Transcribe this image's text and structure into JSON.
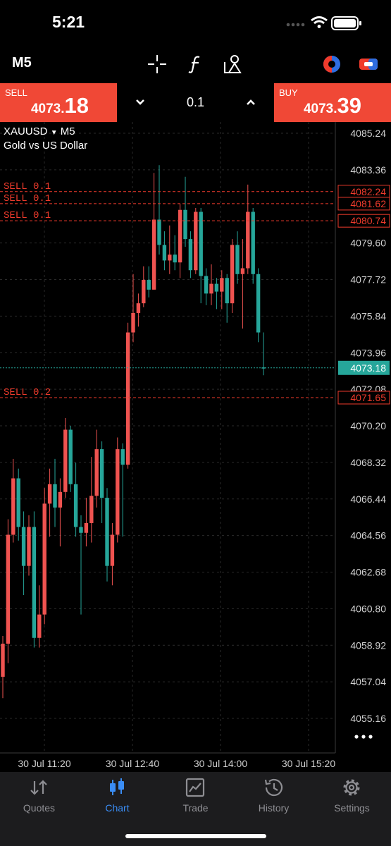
{
  "status_bar": {
    "time": "5:21"
  },
  "toolbar": {
    "timeframe": "M5",
    "icons": [
      "crosshair-icon",
      "function-icon",
      "objects-icon",
      "chart-color-icon",
      "one-click-trading-icon"
    ]
  },
  "trade": {
    "sell_label": "SELL",
    "sell_price_main": "4073.",
    "sell_price_big": "18",
    "buy_label": "BUY",
    "buy_price_main": "4073.",
    "buy_price_big": "39",
    "volume": "0.1"
  },
  "chart": {
    "symbol": "XAUUSD",
    "timeframe": "M5",
    "description": "Gold vs US Dollar",
    "bid_label": "4073.18",
    "orders": [
      {
        "text": "SELL 0.1",
        "price": 4082.24,
        "label": "4082.24"
      },
      {
        "text": "SELL 0.1",
        "price": 4081.62,
        "label": "4081.62"
      },
      {
        "text": "SELL 0.1",
        "price": 4080.74,
        "label": "4080.74"
      },
      {
        "text": "SELL 0.2",
        "price": 4071.65,
        "label": "4071.65"
      }
    ],
    "colors": {
      "bull": "#26a69a",
      "bear": "#ef5350",
      "order": "#ef3b2c",
      "bid": "#26a69a",
      "grid": "#2a2a2a"
    }
  },
  "chart_data": {
    "type": "candlestick",
    "y_ticks": [
      "4085.24",
      "4083.36",
      "4079.60",
      "4077.72",
      "4075.84",
      "4073.96",
      "4072.08",
      "4070.20",
      "4068.32",
      "4066.44",
      "4064.56",
      "4062.68",
      "4060.80",
      "4058.92",
      "4057.04",
      "4055.16"
    ],
    "x_ticks": [
      "30 Jul 11:20",
      "30 Jul 12:40",
      "30 Jul 14:00",
      "30 Jul 15:20"
    ],
    "ylim": [
      4054.5,
      4086.0
    ],
    "candles": [
      [
        4059.0,
        4059.4,
        4056.2,
        4057.3
      ],
      [
        4064.6,
        4065.4,
        4058.0,
        4059.0
      ],
      [
        4067.5,
        4068.5,
        4064.2,
        4064.6
      ],
      [
        4065.0,
        4068.0,
        4064.3,
        4067.5
      ],
      [
        4063.0,
        4065.8,
        4061.5,
        4065.0
      ],
      [
        4065.0,
        4065.6,
        4062.5,
        4063.0
      ],
      [
        4059.3,
        4065.8,
        4058.8,
        4065.0
      ],
      [
        4060.5,
        4062.0,
        4058.8,
        4059.3
      ],
      [
        4066.2,
        4067.0,
        4060.0,
        4060.5
      ],
      [
        4067.2,
        4068.0,
        4064.5,
        4066.2
      ],
      [
        4066.0,
        4068.5,
        4065.0,
        4067.2
      ],
      [
        4066.8,
        4067.5,
        4064.0,
        4066.0
      ],
      [
        4070.0,
        4070.6,
        4066.5,
        4066.8
      ],
      [
        4067.2,
        4070.2,
        4066.8,
        4070.0
      ],
      [
        4065.0,
        4068.3,
        4064.5,
        4067.2
      ],
      [
        4064.7,
        4065.6,
        4060.5,
        4065.0
      ],
      [
        4065.2,
        4066.5,
        4064.0,
        4064.7
      ],
      [
        4066.6,
        4068.6,
        4064.2,
        4065.2
      ],
      [
        4069.0,
        4070.0,
        4066.0,
        4066.6
      ],
      [
        4066.5,
        4069.4,
        4065.2,
        4069.0
      ],
      [
        4063.0,
        4067.0,
        4062.2,
        4066.5
      ],
      [
        4064.6,
        4065.2,
        4062.0,
        4063.0
      ],
      [
        4069.0,
        4069.6,
        4064.2,
        4064.6
      ],
      [
        4068.2,
        4069.3,
        4064.5,
        4069.0
      ],
      [
        4075.0,
        4075.5,
        4068.0,
        4068.2
      ],
      [
        4076.0,
        4078.0,
        4074.5,
        4075.0
      ],
      [
        4076.5,
        4077.0,
        4075.3,
        4076.0
      ],
      [
        4077.7,
        4078.4,
        4076.3,
        4076.5
      ],
      [
        4077.2,
        4078.4,
        4076.8,
        4077.7
      ],
      [
        4080.8,
        4083.2,
        4077.2,
        4077.2
      ],
      [
        4079.5,
        4083.6,
        4079.0,
        4080.8
      ],
      [
        4078.7,
        4080.2,
        4078.2,
        4079.5
      ],
      [
        4079.0,
        4080.5,
        4078.0,
        4078.7
      ],
      [
        4078.6,
        4080.0,
        4078.2,
        4079.0
      ],
      [
        4081.3,
        4081.6,
        4077.8,
        4078.6
      ],
      [
        4079.8,
        4083.0,
        4079.4,
        4081.3
      ],
      [
        4078.2,
        4080.2,
        4077.8,
        4079.8
      ],
      [
        4081.2,
        4081.4,
        4078.0,
        4078.2
      ],
      [
        4077.9,
        4081.4,
        4076.5,
        4081.2
      ],
      [
        4077.0,
        4078.3,
        4076.4,
        4077.9
      ],
      [
        4077.5,
        4078.5,
        4076.4,
        4077.0
      ],
      [
        4077.1,
        4077.8,
        4076.2,
        4077.5
      ],
      [
        4077.8,
        4078.2,
        4076.2,
        4077.1
      ],
      [
        4076.5,
        4078.0,
        4075.5,
        4077.8
      ],
      [
        4079.5,
        4079.8,
        4076.0,
        4076.5
      ],
      [
        4078.0,
        4080.2,
        4077.5,
        4079.5
      ],
      [
        4078.3,
        4079.8,
        4075.2,
        4078.0
      ],
      [
        4081.2,
        4082.6,
        4078.0,
        4078.3
      ],
      [
        4078.0,
        4081.4,
        4077.5,
        4081.2
      ],
      [
        4075.0,
        4078.3,
        4074.5,
        4078.0
      ],
      [
        4073.2,
        4075.0,
        4072.8,
        4073.2
      ]
    ]
  },
  "nav": {
    "items": [
      {
        "label": "Quotes",
        "icon": "quotes-icon"
      },
      {
        "label": "Chart",
        "icon": "chart-icon"
      },
      {
        "label": "Trade",
        "icon": "trade-icon"
      },
      {
        "label": "History",
        "icon": "history-icon"
      },
      {
        "label": "Settings",
        "icon": "settings-icon"
      }
    ],
    "active": "Chart"
  }
}
